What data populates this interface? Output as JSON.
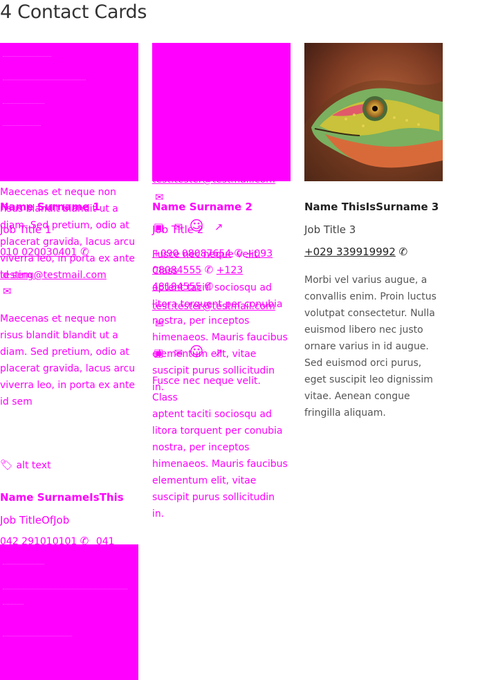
{
  "page": {
    "title": "4 Contact Cards"
  },
  "icons": {
    "phone": "phone-icon",
    "email": "email-icon",
    "chat": "chat-icon",
    "smiley": "smiley-icon",
    "external": "external-link-icon",
    "tag": "tag-icon"
  },
  "colors": {
    "overlay": "#ff00ff",
    "text": "#222222",
    "muted": "#555555"
  },
  "card1": {
    "name": "Name Surname 1",
    "job": "Job Title 1",
    "phone": "010 020030401",
    "email": "testing@testmail.com",
    "bio_overlap": "Maecenas et neque non risus blandit blandit ut a diam. Sed pretium, odio at placerat gravida, lacus arcu viverra leo, in porta ex ante id sem",
    "bio": [
      "Maecenas et neque non",
      "risus blandit blandit ut a",
      "diam. Sed pretium, odio at",
      "placerat gravida, lacus arcu",
      "viverra leo, in porta ex ante",
      "id sem"
    ]
  },
  "card2": {
    "name": "Name Surname 2",
    "job": "Job Title 2",
    "email_top": "test.tester@testmail.com",
    "phone": "+090 08087654",
    "phone2": "+093 08084555",
    "phone3": "+123 48184555",
    "email": "test.tester@testmail.com",
    "bio": [
      "Fusce nec neque velit. Class",
      "aptent taciti sociosqu ad",
      "litora torquent per conubia",
      "nostra, per inceptos",
      "himenaeos. Mauris faucibus",
      "elementum elit, vitae",
      "suscipit purus sollicitudin",
      "in."
    ]
  },
  "card3": {
    "name": "Name ThisIsSurname 3",
    "job": "Job Title 3",
    "phone": "+029 339919992",
    "bio": [
      "Morbi vel varius augue, a",
      "convallis enim. Proin luctus",
      "volutpat consectetur. Nulla",
      "euismod libero nec justo",
      "ornare varius in id augue.",
      "Sed euismod orci purus,",
      "eget suscipit leo dignissim",
      "vitae. Aenean congue",
      "fringilla aliquam."
    ]
  },
  "card4": {
    "image_alt": "alt text",
    "name": "Name SurnameIsThis",
    "job": "Job TitleOfJob",
    "phone": "042 291010101",
    "phone2": "041"
  }
}
